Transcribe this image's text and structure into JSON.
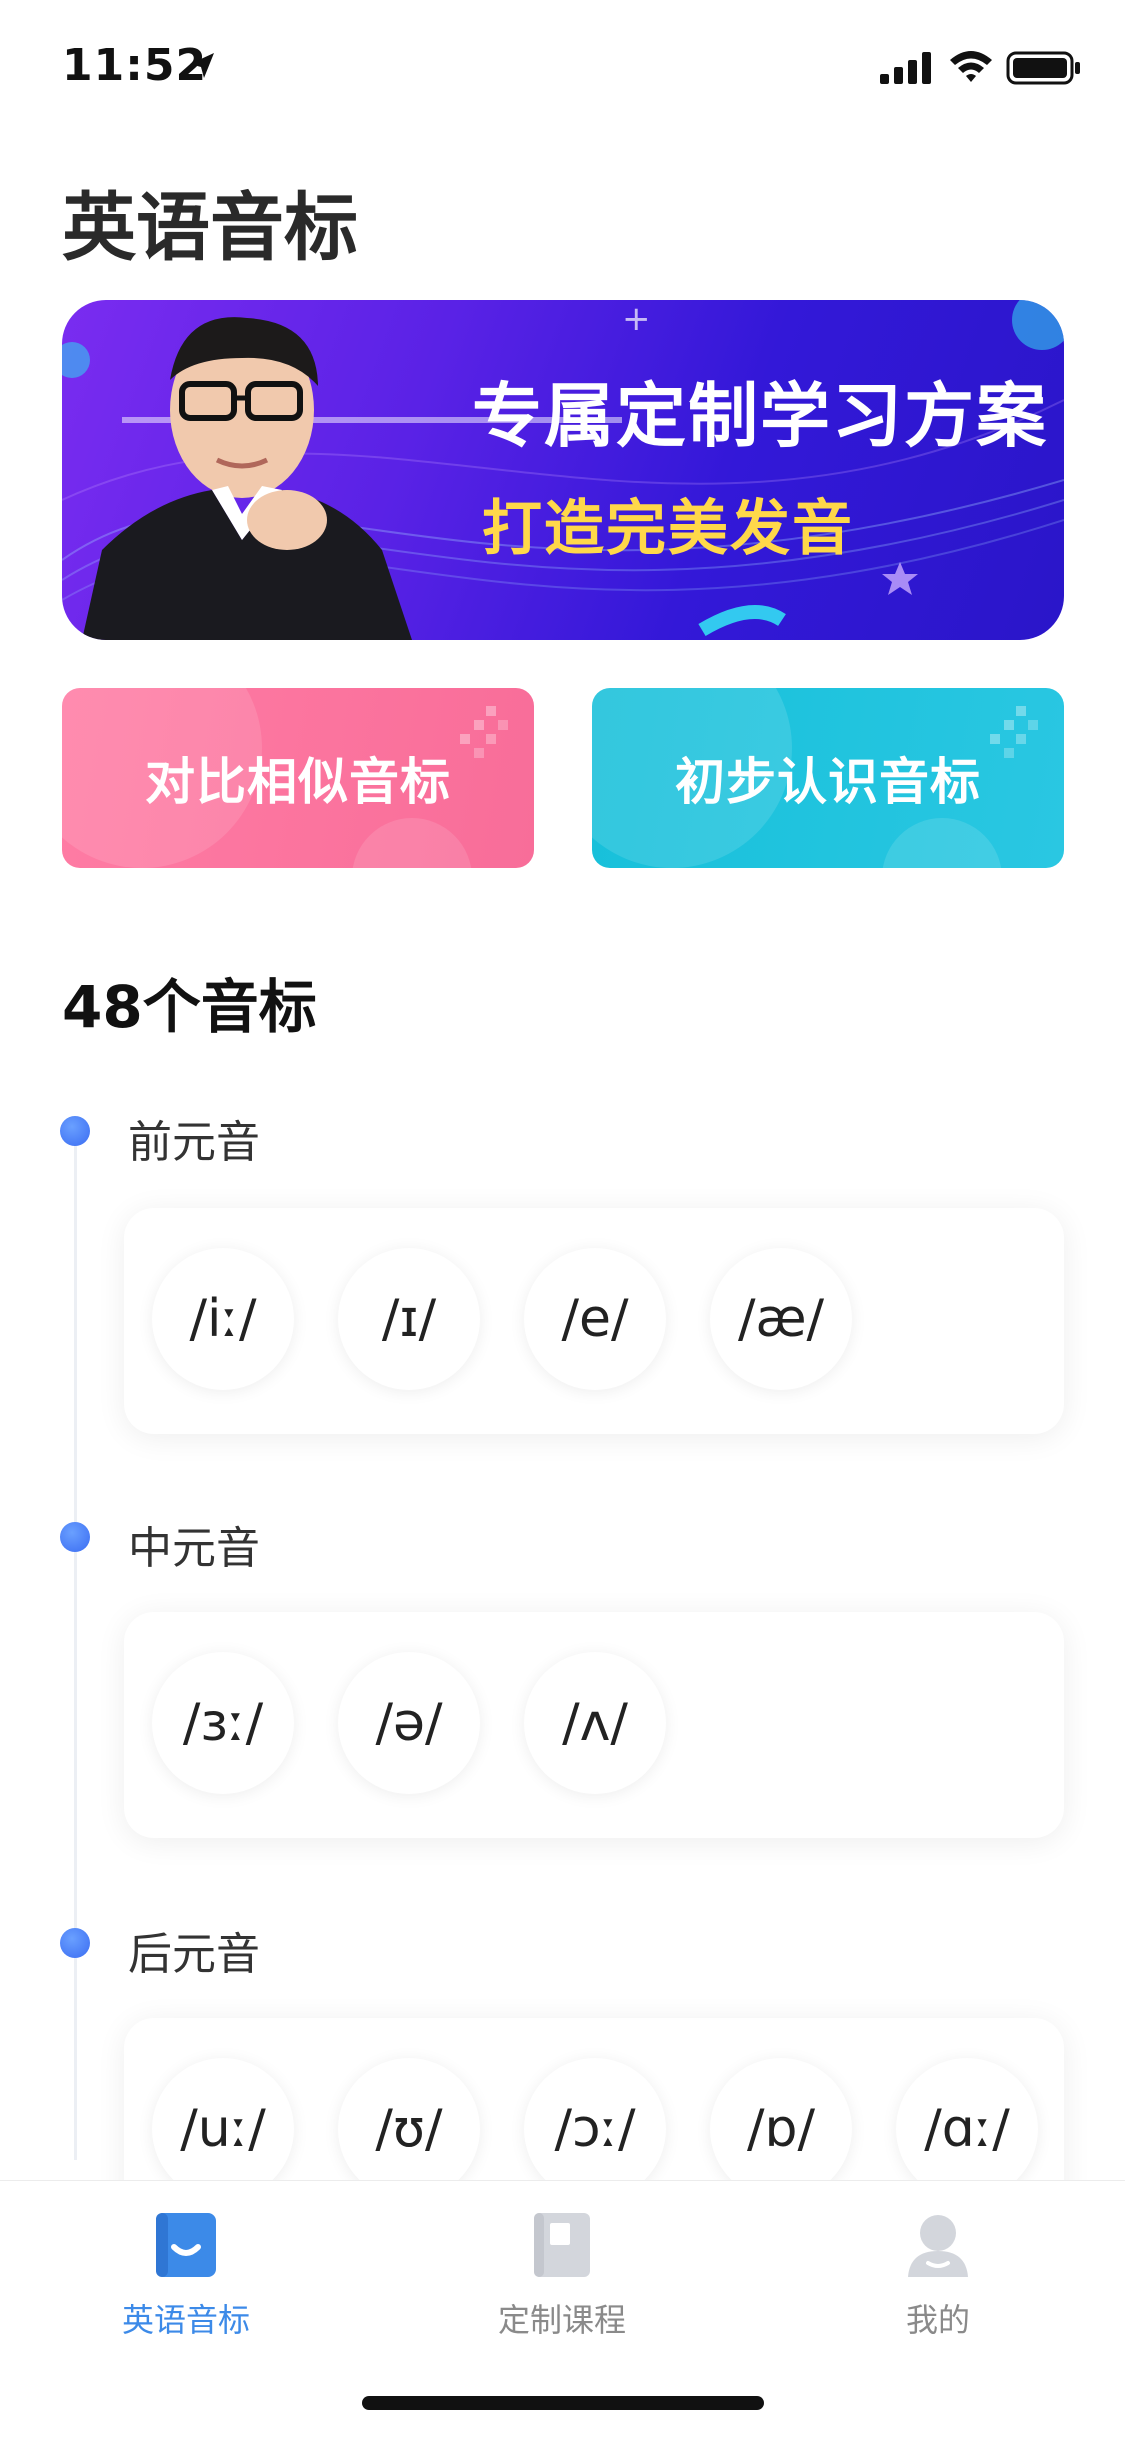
{
  "status_bar": {
    "time": "11:52"
  },
  "page": {
    "title": "英语音标"
  },
  "banner": {
    "line1": "专属定制学习方案",
    "line2": "打造完美发音"
  },
  "features": [
    {
      "label": "对比相似音标",
      "color": "#f86d99"
    },
    {
      "label": "初步认识音标",
      "color": "#17c0da"
    }
  ],
  "section": {
    "heading": "48个音标"
  },
  "groups": [
    {
      "title": "前元音",
      "phonemes": [
        "/iː/",
        "/ɪ/",
        "/e/",
        "/æ/"
      ]
    },
    {
      "title": "中元音",
      "phonemes": [
        "/ɜː/",
        "/ə/",
        "/ʌ/"
      ]
    },
    {
      "title": "后元音",
      "phonemes": [
        "/uː/",
        "/ʊ/",
        "/ɔː/",
        "/ɒ/",
        "/ɑː/"
      ]
    }
  ],
  "tabs": [
    {
      "label": "英语音标",
      "icon": "smile-book-icon",
      "active": true
    },
    {
      "label": "定制课程",
      "icon": "book-icon",
      "active": false
    },
    {
      "label": "我的",
      "icon": "person-icon",
      "active": false
    }
  ],
  "colors": {
    "accent": "#3c8ae8",
    "dot": "#3a6cf2",
    "banner": "#5a22e6"
  }
}
